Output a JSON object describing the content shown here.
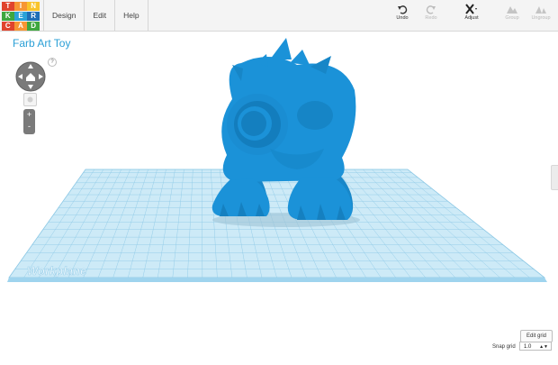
{
  "app": {
    "logo_letters": [
      "T",
      "I",
      "N",
      "K",
      "E",
      "R",
      "C",
      "A",
      "D"
    ],
    "logo_colors": [
      "#e0442d",
      "#f79633",
      "#f9c42a",
      "#3fa73f",
      "#2aa2d8",
      "#1f6fb6",
      "#e0442d",
      "#f79633",
      "#3fa73f"
    ]
  },
  "menu": {
    "items": [
      "Design",
      "Edit",
      "Help"
    ]
  },
  "toolbar": {
    "undo": "Undo",
    "redo": "Redo",
    "adjust": "Adjust",
    "group": "Group",
    "ungroup": "Ungroup"
  },
  "design": {
    "title": "Farb Art Toy"
  },
  "nav": {
    "help": "?",
    "zoom_in": "+",
    "zoom_out": "-"
  },
  "workplane": {
    "label": "Workplane"
  },
  "grid": {
    "edit_label": "Edit grid",
    "snap_label": "Snap grid",
    "snap_value": "1.0"
  },
  "colors": {
    "accent": "#2a9fd6",
    "model": "#1b92d8",
    "grid": "#bfe3f4"
  }
}
